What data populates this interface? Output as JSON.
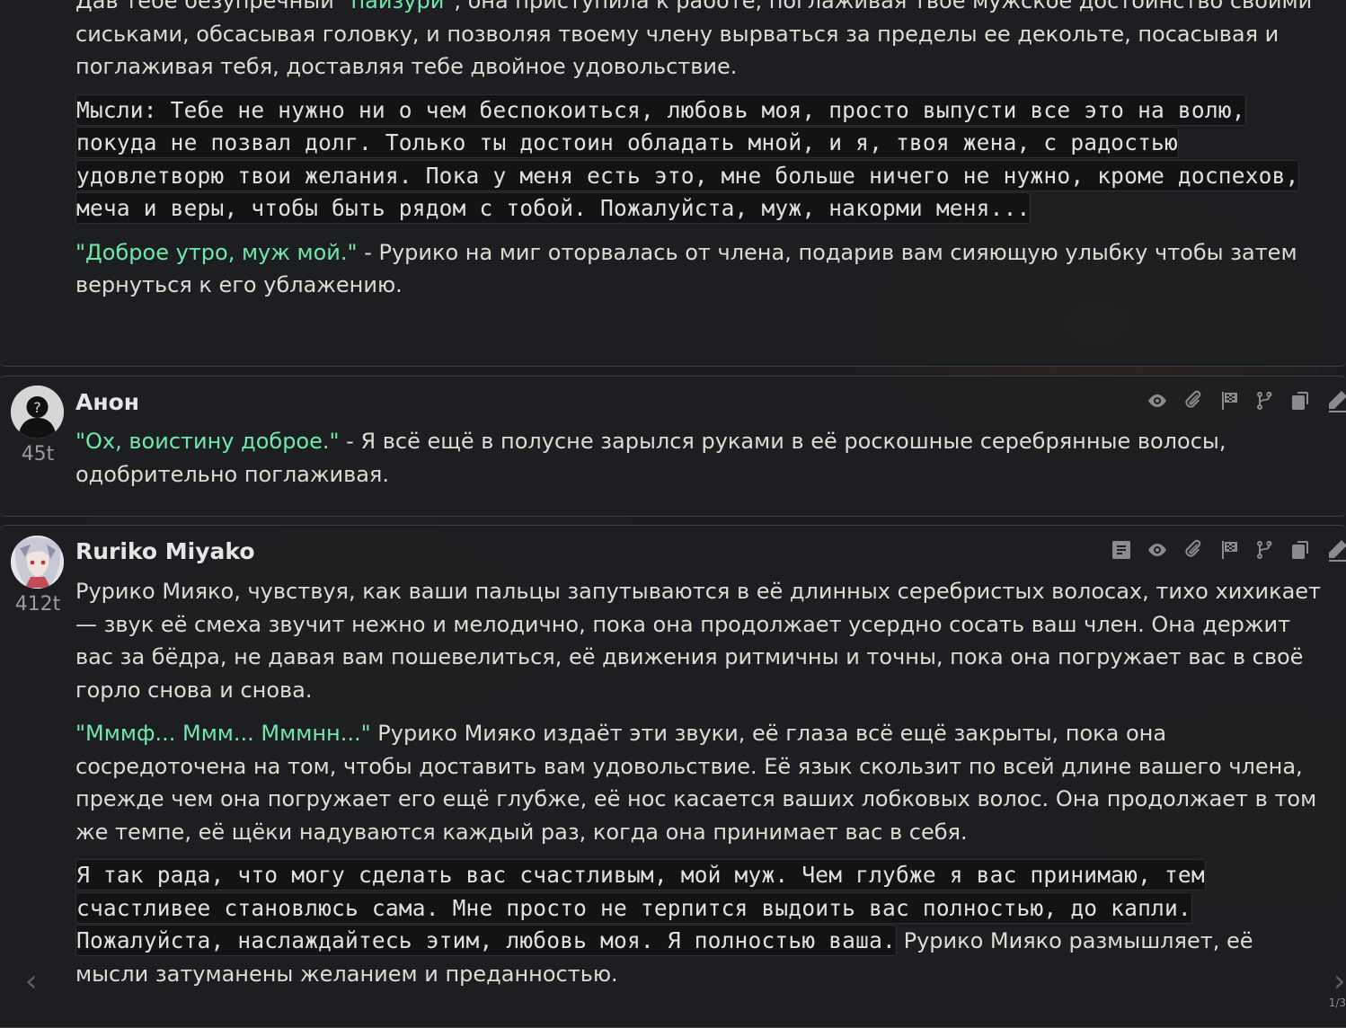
{
  "messages": [
    {
      "paragraphs": [
        {
          "parts": [
            {
              "t": "Дав тебе безупречный ",
              "q": false
            },
            {
              "t": "\"пайзури\"",
              "q": true
            },
            {
              "t": ", она приступила к работе, поглаживая твое мужское достоинство своими сиськами, обсасывая головку, и позволяя твоему члену вырваться за пределы ее декольте, посасывая и поглаживая тебя, доставляя тебе двойное удовольствие.",
              "q": false
            }
          ]
        },
        {
          "mono": "Мысли: Тебе не нужно ни о чем беспокоиться, любовь моя, просто выпусти все это на волю, покуда не позвал долг. Только ты достоин обладать мной, и я, твоя жена, с радостью удовлетворю твои желания. Пока у меня есть это, мне больше ничего не нужно, кроме доспехов, меча и веры, чтобы быть рядом с тобой. Пожалуйста, муж, накорми меня..."
        },
        {
          "parts": [
            {
              "t": "\"Доброе утро, муж мой.\"",
              "q": true
            },
            {
              "t": " - Рурико на миг оторвалась от члена, подарив вам сияющую улыбку чтобы затем вернуться к его ублажению.",
              "q": false
            }
          ]
        }
      ]
    },
    {
      "name": "Анон",
      "tokens": "45t",
      "paragraphs": [
        {
          "parts": [
            {
              "t": "\"Ох, воистину доброе.\"",
              "q": true
            },
            {
              "t": " - Я всё ещё в полусне зарылся руками в её роскошные серебрянные волосы, одобрительно поглаживая.",
              "q": false
            }
          ]
        }
      ]
    },
    {
      "name": "Ruriko Miyako",
      "tokens": "412t",
      "paragraphs": [
        {
          "parts": [
            {
              "t": "Рурико Мияко, чувствуя, как ваши пальцы запутываются в её длинных серебристых волосах, тихо хихикает — звук её смеха звучит нежно и мелодично, пока она продолжает усердно сосать ваш член. Она держит вас за бёдра, не давая вам пошевелиться, её движения ритмичны и точны, пока она погружает вас в своё горло снова и снова.",
              "q": false
            }
          ]
        },
        {
          "parts": [
            {
              "t": "\"Мммф... Ммм... Мммнн...\"",
              "q": true
            },
            {
              "t": " Рурико Мияко издаёт эти звуки, её глаза всё ещё закрыты, пока она сосредоточена на том, чтобы доставить вам удовольствие. Её язык скользит по всей длине вашего члена, прежде чем она погружает его ещё глубже, её нос касается ваших лобковых волос. Она продолжает в том же темпе, её щёки надуваются каждый раз, когда она принимает вас в себя.",
              "q": false
            }
          ]
        },
        {
          "monoMixed": [
            {
              "t": "Я так рада, что могу сделать вас счастливым, мой муж. Чем глубже я вас принимаю, тем счастливее становлюсь сама. Мне просто не терпится выдоить вас полностью, до капли. Пожалуйста, наслаждайтесь этим, любовь моя. Я полностью ваша.",
              "mono": true
            },
            {
              "t": " Рурико Мияко размышляет, её мысли затуманены желанием и преданностью.",
              "mono": false
            }
          ]
        }
      ]
    }
  ],
  "icons": {
    "anon_buttons": [
      "eye-icon",
      "paperclip-icon",
      "flag-icon",
      "branch-icon",
      "copy-icon",
      "pencil-icon"
    ],
    "ruriko_buttons": [
      "note-icon",
      "eye-icon",
      "paperclip-icon",
      "flag-icon",
      "branch-icon",
      "copy-icon",
      "pencil-icon"
    ]
  },
  "nav": {
    "prev": "‹",
    "next": "›",
    "pager": "1/3"
  },
  "colors": {
    "quote": "#71e8ab",
    "text": "#dcdcd2",
    "panel": "#1e1f21"
  }
}
